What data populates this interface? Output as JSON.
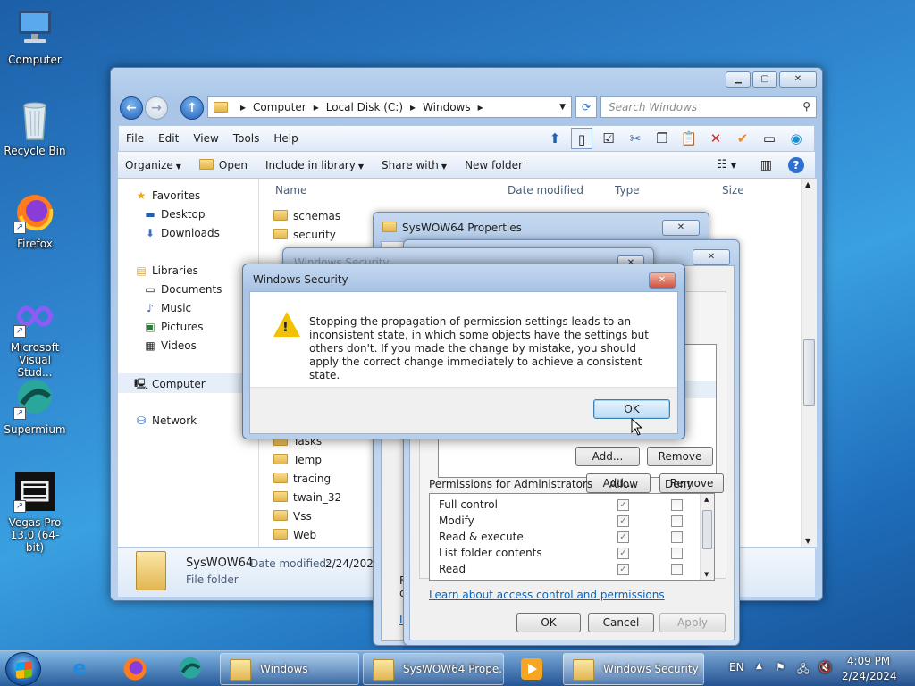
{
  "desktop": {
    "icons": [
      {
        "label": "Computer",
        "icon": "computer-icon"
      },
      {
        "label": "Recycle Bin",
        "icon": "recycle-bin-icon"
      },
      {
        "label": "Firefox",
        "icon": "firefox-icon"
      },
      {
        "label": "Microsoft Visual Stud...",
        "icon": "visual-studio-icon"
      },
      {
        "label": "Supermium",
        "icon": "supermium-icon"
      },
      {
        "label": "Vegas Pro 13.0 (64-bit)",
        "icon": "vegas-pro-icon"
      }
    ]
  },
  "explorer": {
    "breadcrumb": [
      "Computer",
      "Local Disk (C:)",
      "Windows"
    ],
    "search_placeholder": "Search Windows",
    "menu": [
      "File",
      "Edit",
      "View",
      "Tools",
      "Help"
    ],
    "commands": {
      "organize": "Organize",
      "open": "Open",
      "include": "Include in library",
      "share": "Share with",
      "new_folder": "New folder"
    },
    "nav": {
      "favorites": "Favorites",
      "desktop": "Desktop",
      "downloads": "Downloads",
      "libraries": "Libraries",
      "documents": "Documents",
      "music": "Music",
      "pictures": "Pictures",
      "videos": "Videos",
      "computer": "Computer",
      "network": "Network"
    },
    "columns": {
      "name": "Name",
      "date": "Date modified",
      "type": "Type",
      "size": "Size"
    },
    "files_top": [
      "schemas",
      "security"
    ],
    "files_bottom": [
      "Tasks",
      "Temp",
      "tracing",
      "twain_32",
      "Vss",
      "Web"
    ],
    "details": {
      "name": "SysWOW64",
      "date_label": "Date modified:",
      "date_value": "2/24/2024",
      "type": "File folder"
    }
  },
  "properties": {
    "title": "SysWOW64 Properties",
    "hidden_title": "Windows Security",
    "add_button": "Add...",
    "remove_button": "Remove",
    "permissions_label": "Permissions for Administrators",
    "allow_label": "Allow",
    "deny_label": "Deny",
    "permissions": [
      {
        "name": "Full control",
        "allow": true,
        "deny": false
      },
      {
        "name": "Modify",
        "allow": true,
        "deny": false
      },
      {
        "name": "Read & execute",
        "allow": true,
        "deny": false
      },
      {
        "name": "List folder contents",
        "allow": true,
        "deny": false
      },
      {
        "name": "Read",
        "allow": true,
        "deny": false
      }
    ],
    "learn_link": "Learn about access control and permissions",
    "ok": "OK",
    "cancel": "Cancel",
    "apply": "Apply",
    "left_fragments": [
      "F",
      "c",
      "L"
    ]
  },
  "security_dialog": {
    "title": "Windows Security",
    "message": "Stopping the propagation of permission settings leads to an inconsistent state, in which some objects have the settings but others don't. If you made the change by mistake, you should apply the correct change immediately to achieve a consistent state.",
    "ok": "OK"
  },
  "taskbar": {
    "tasks": [
      "Windows",
      "SysWOW64 Prope...",
      "Windows Security"
    ],
    "lang": "EN",
    "time": "4:09 PM",
    "date": "2/24/2024"
  }
}
